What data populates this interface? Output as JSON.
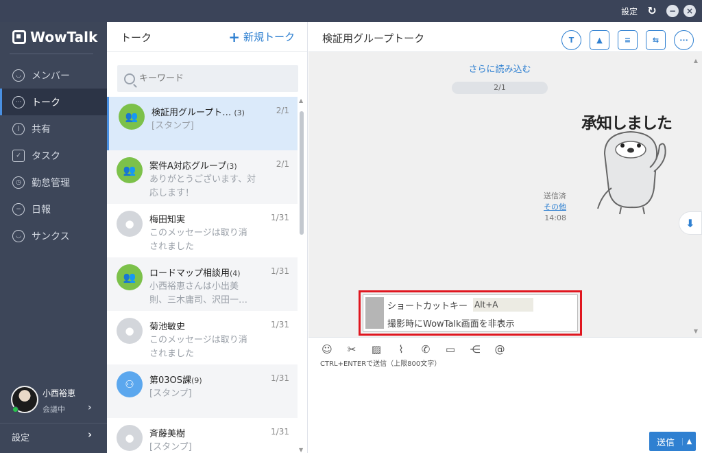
{
  "titlebar": {
    "settings": "設定"
  },
  "app": {
    "name": "WowTalk"
  },
  "nav": [
    {
      "label": "メンバー",
      "icon": "user-icon"
    },
    {
      "label": "トーク",
      "icon": "chat-icon",
      "active": true
    },
    {
      "label": "共有",
      "icon": "share-icon"
    },
    {
      "label": "タスク",
      "icon": "task-icon"
    },
    {
      "label": "勤怠管理",
      "icon": "attendance-icon"
    },
    {
      "label": "日報",
      "icon": "report-icon"
    },
    {
      "label": "サンクス",
      "icon": "thanks-icon"
    }
  ],
  "profile": {
    "name": "小西裕恵",
    "status": "会議中"
  },
  "sidebar_settings": "設定",
  "talklist": {
    "title": "トーク",
    "new_label": "新規トーク",
    "search_placeholder": "キーワード",
    "items": [
      {
        "name": "検証用グループト…",
        "count": "(3)",
        "date": "2/1",
        "preview": "[スタンプ]",
        "type": "group"
      },
      {
        "name": "案件A対応グループ",
        "count": "(3)",
        "date": "2/1",
        "preview": "ありがとうございます、対応します！",
        "type": "group"
      },
      {
        "name": "梅田知実",
        "count": "",
        "date": "1/31",
        "preview": "このメッセージは取り消されました",
        "type": "person"
      },
      {
        "name": "ロードマップ相談用",
        "count": "(4)",
        "date": "1/31",
        "preview": "小西裕恵さんは小出美則、三木庸司、沢田一…",
        "type": "group"
      },
      {
        "name": "菊池敏史",
        "count": "",
        "date": "1/31",
        "preview": "このメッセージは取り消されました",
        "type": "person"
      },
      {
        "name": "第03OS課",
        "count": "(9)",
        "date": "1/31",
        "preview": "[スタンプ]",
        "type": "org"
      },
      {
        "name": "斉藤美樹",
        "count": "",
        "date": "1/31",
        "preview": "[スタンプ]",
        "type": "person"
      }
    ]
  },
  "chat": {
    "title": "検証用グループトーク",
    "load_more": "さらに読み込む",
    "page": "2/1",
    "sticker_text": "承知しました",
    "meta": {
      "sent": "送信済",
      "other": "その他",
      "time": "14:08"
    },
    "shortcut": {
      "label": "ショートカットキー",
      "key": "Alt+A",
      "desc": "撮影時にWowTalk画面を非表示"
    },
    "hint": "CTRL+ENTERで送信（上限800文字）",
    "send": "送信"
  },
  "colors": {
    "accent": "#2f80d1",
    "sidebar": "#3d4659",
    "highlight": "#e0161f"
  }
}
